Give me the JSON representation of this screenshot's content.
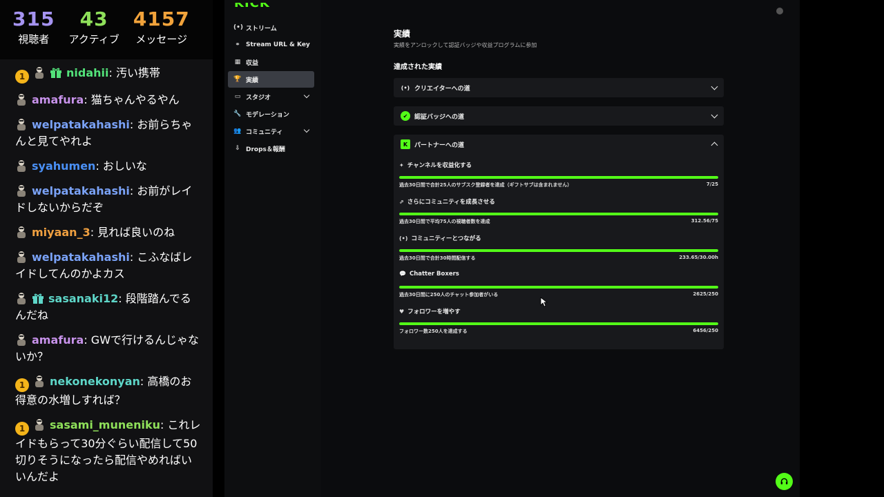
{
  "stats": [
    {
      "value": "315",
      "label": "視聴者"
    },
    {
      "value": "43",
      "label": "アクティブ"
    },
    {
      "value": "4157",
      "label": "メッセージ"
    }
  ],
  "chat": [
    {
      "badge": "1",
      "gift": "green",
      "user": "nidahii",
      "color": "#53e37a",
      "text": ": 汚い携帯"
    },
    {
      "badge": "",
      "gift": "",
      "user": "amafura",
      "color": "#c792ea",
      "text": ": 猫ちゃんやるやん"
    },
    {
      "badge": "",
      "gift": "",
      "user": "welpatakahashi",
      "color": "#7aa2f7",
      "text": ": お前らちゃんと見てやれよ"
    },
    {
      "badge": "",
      "gift": "",
      "user": "syahumen",
      "color": "#4a90f5",
      "text": ": おしいな"
    },
    {
      "badge": "",
      "gift": "",
      "user": "welpatakahashi",
      "color": "#7aa2f7",
      "text": ": お前がレイドしないからだぞ"
    },
    {
      "badge": "",
      "gift": "",
      "user": "miyaan_3",
      "color": "#f0a040",
      "text": ": 見れば良いのね"
    },
    {
      "badge": "",
      "gift": "",
      "user": "welpatakahashi",
      "color": "#7aa2f7",
      "text": ": こふなばレイドしてんのかよカス"
    },
    {
      "badge": "",
      "gift": "teal",
      "user": "sasanaki12",
      "color": "#5ed6c8",
      "text": ": 段階踏んでるんだね"
    },
    {
      "badge": "",
      "gift": "",
      "user": "amafura",
      "color": "#c792ea",
      "text": ": GWで行けるんじゃないか？"
    },
    {
      "badge": "1",
      "gift": "",
      "user": "nekonekonyan",
      "color": "#5ed6c8",
      "text": ": 高橋のお得意の水増しすれば？"
    },
    {
      "badge": "1",
      "gift": "",
      "user": "sasami_muneniku",
      "color": "#8fe05a",
      "text": ": これレイドもらって30分ぐらい配信して50切りそうになったら配信やめればいいんだよ"
    }
  ],
  "sidebar": {
    "logo": "KICK",
    "items": [
      {
        "icon": "(•)",
        "label": "ストリーム",
        "chevron": false,
        "active": false
      },
      {
        "icon": "⚭",
        "label": "Stream URL & Key",
        "chevron": false,
        "active": false
      },
      {
        "icon": "▦",
        "label": "収益",
        "chevron": false,
        "active": false
      },
      {
        "icon": "🏆",
        "label": "実績",
        "chevron": false,
        "active": true
      },
      {
        "icon": "▭",
        "label": "スタジオ",
        "chevron": true,
        "active": false
      },
      {
        "icon": "🔧",
        "label": "モデレーション",
        "chevron": false,
        "active": false
      },
      {
        "icon": "👥",
        "label": "コミュニティ",
        "chevron": true,
        "active": false
      },
      {
        "icon": "⇩",
        "label": "Drops＆報酬",
        "chevron": false,
        "active": false
      }
    ]
  },
  "main": {
    "title": "実績",
    "subtitle": "実績をアンロックして認証バッジや収益プログラムに参加",
    "section": "達成された実績",
    "accordions": [
      {
        "icon": "(•)",
        "label": "クリエイターへの道",
        "open": false
      },
      {
        "icon": "✔",
        "label": "認証バッジへの道",
        "open": false
      },
      {
        "icon": "K",
        "label": "パートナーへの道",
        "open": true
      }
    ],
    "goals": [
      {
        "icon": "✦",
        "title": "チャンネルを収益化する",
        "desc": "過去30日間で合計25人のサブスク登録者を達成（ギフトサブは含まれません）",
        "value": "7/25",
        "progress": 1.0
      },
      {
        "icon": "⇗",
        "title": "さらにコミュニティを成長させる",
        "desc": "過去30日間で平均75人の視聴者数を達成",
        "value": "312.56/75",
        "progress": 1.0
      },
      {
        "icon": "(•)",
        "title": "コミュニティーとつながる",
        "desc": "過去30日間で合計30時間配信する",
        "value": "233.65/30.00h",
        "progress": 1.0
      },
      {
        "icon": "💬",
        "title": "Chatter Boxers",
        "desc": "過去30日間に250人のチャット参加者がいる",
        "value": "2625/250",
        "progress": 1.0
      },
      {
        "icon": "♥",
        "title": "フォロワーを増やす",
        "desc": "フォロワー数250人を達成する",
        "value": "6456/250",
        "progress": 1.0
      }
    ]
  },
  "colors": {
    "accent": "#53fc18",
    "panel": "#18191c",
    "badge": "#f4b41a"
  }
}
